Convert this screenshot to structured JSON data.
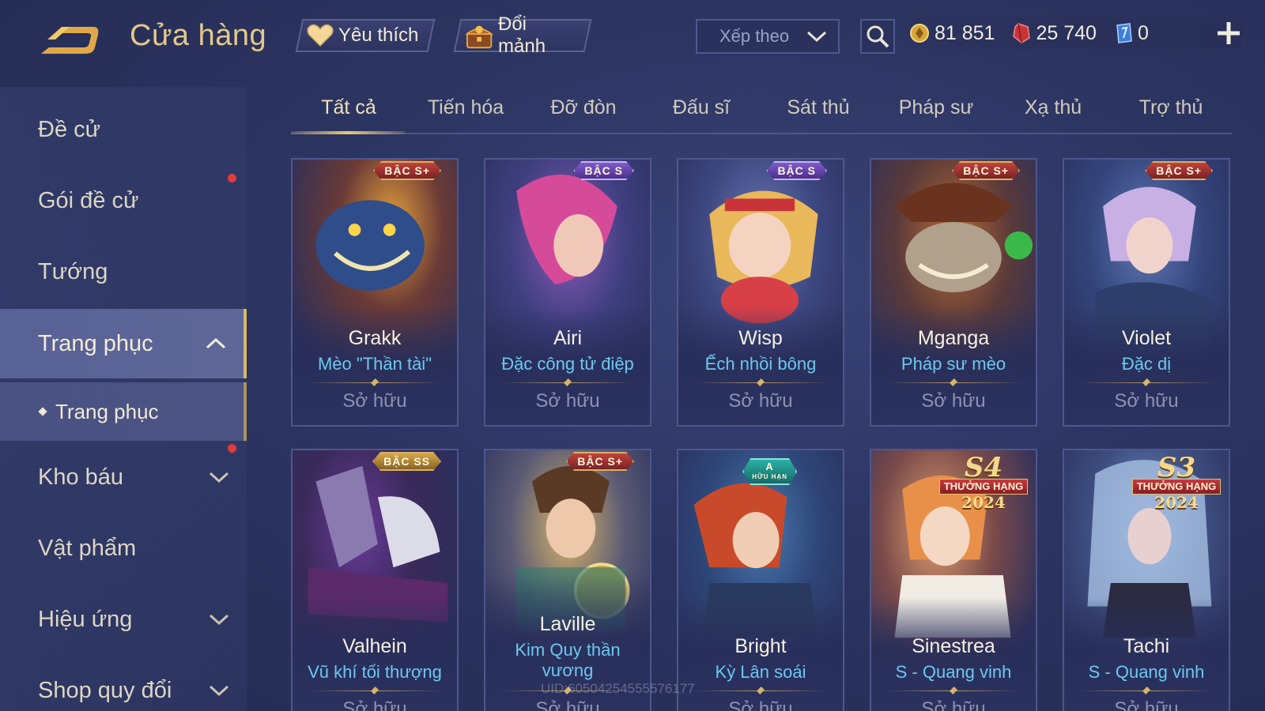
{
  "header": {
    "title": "Cửa hàng",
    "favorite_label": "Yêu thích",
    "shard_label": "Đổi mảnh",
    "sort_label": "Xếp theo",
    "currencies": [
      {
        "icon": "gold-coin-icon",
        "value": "81 851"
      },
      {
        "icon": "red-gem-icon",
        "value": "25 740"
      },
      {
        "icon": "blue-voucher-icon",
        "value": "0"
      }
    ]
  },
  "sidebar": {
    "items": [
      {
        "label": "Đề cử"
      },
      {
        "label": "Gói đề cử"
      },
      {
        "label": "Tướng"
      },
      {
        "label": "Trang phục"
      },
      {
        "label": "Trang phục"
      },
      {
        "label": "Kho báu"
      },
      {
        "label": "Vật phẩm"
      },
      {
        "label": "Hiệu ứng"
      },
      {
        "label": "Shop quy đổi"
      }
    ]
  },
  "tabs": [
    "Tất cả",
    "Tiến hóa",
    "Đỡ đòn",
    "Đấu sĩ",
    "Sát thủ",
    "Pháp sư",
    "Xạ thủ",
    "Trợ thủ"
  ],
  "cards": [
    {
      "hero": "Grakk",
      "skin": "Mèo \"Thần tài\"",
      "status": "Sở hữu",
      "badge": "BẬC S+"
    },
    {
      "hero": "Airi",
      "skin": "Đặc công tử điệp",
      "status": "Sở hữu",
      "badge": "BẬC S"
    },
    {
      "hero": "Wisp",
      "skin": "Ếch nhồi bông",
      "status": "Sở hữu",
      "badge": "BẬC S"
    },
    {
      "hero": "Mganga",
      "skin": "Pháp sư mèo",
      "status": "Sở hữu",
      "badge": "BẬC S+"
    },
    {
      "hero": "Violet",
      "skin": "Đặc dị",
      "status": "Sở hữu",
      "badge": "BẬC S+"
    },
    {
      "hero": "Valhein",
      "skin": "Vũ khí tối thượng",
      "status": "Sở hữu",
      "badge": "BẬC SS"
    },
    {
      "hero": "Laville",
      "skin": "Kim Quy thần vương",
      "status": "Sở hữu",
      "badge": "BẬC S+"
    },
    {
      "hero": "Bright",
      "skin": "Kỳ Lân soái",
      "status": "Sở hữu",
      "badge": "A",
      "badge_sub": "HỮU HẠN"
    },
    {
      "hero": "Sinestrea",
      "skin": "S - Quang vinh",
      "status": "Sở hữu",
      "season": "S4",
      "season_ribbon": "THƯỞNG HẠNG",
      "season_year": "2024"
    },
    {
      "hero": "Tachi",
      "skin": "S - Quang vinh",
      "status": "Sở hữu",
      "season": "S3",
      "season_ribbon": "THƯỞNG HẠNG",
      "season_year": "2024"
    }
  ],
  "uid": "UID:60504254555576177",
  "colors": {
    "accent_gold": "#e3c98a",
    "skin_name": "#6cc8ee",
    "notification": "#e23b3b"
  }
}
